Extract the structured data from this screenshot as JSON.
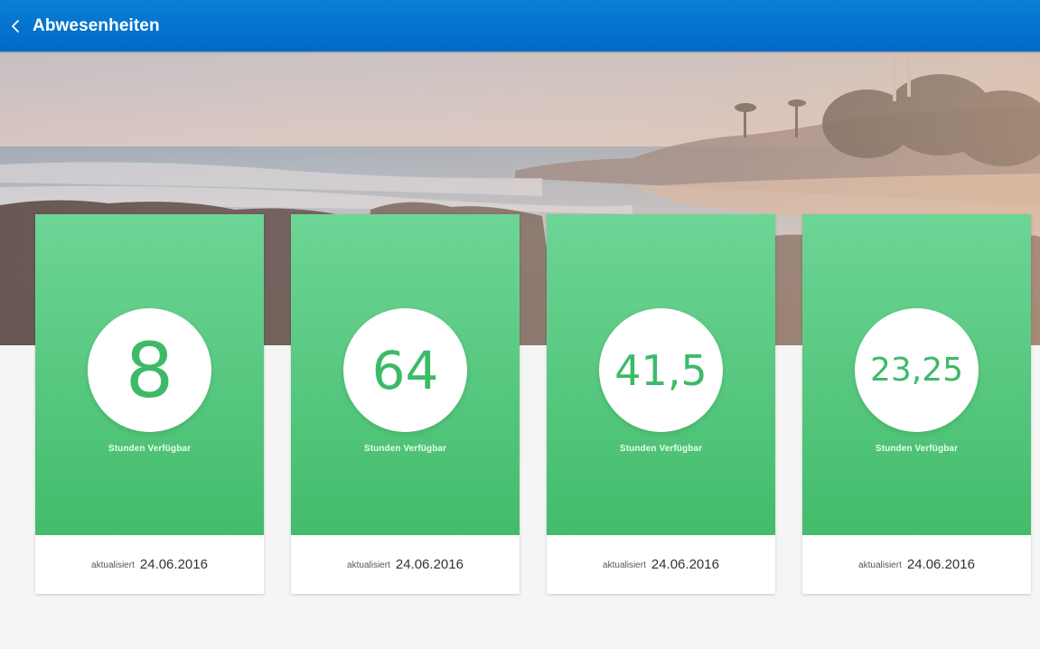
{
  "header": {
    "title": "Abwesenheiten",
    "back_icon": "chevron-left-icon",
    "background": "#0072d0"
  },
  "hero": {
    "description_icon": "beach-sunset-image"
  },
  "cards": [
    {
      "value": "8",
      "caption": "Stunden Verfügbar",
      "updated_label": "aktualisiert",
      "updated_date": "24.06.2016"
    },
    {
      "value": "64",
      "caption": "Stunden Verfügbar",
      "updated_label": "aktualisiert",
      "updated_date": "24.06.2016"
    },
    {
      "value": "41,5",
      "caption": "Stunden Verfügbar",
      "updated_label": "aktualisiert",
      "updated_date": "24.06.2016"
    },
    {
      "value": "23,25",
      "caption": "Stunden Verfügbar",
      "updated_label": "aktualisiert",
      "updated_date": "24.06.2016"
    }
  ],
  "colors": {
    "accent_green": "#3dba67",
    "card_gradient_top": "#6dd596",
    "card_gradient_bottom": "#43bc6b",
    "page_background": "#f5f5f5"
  }
}
